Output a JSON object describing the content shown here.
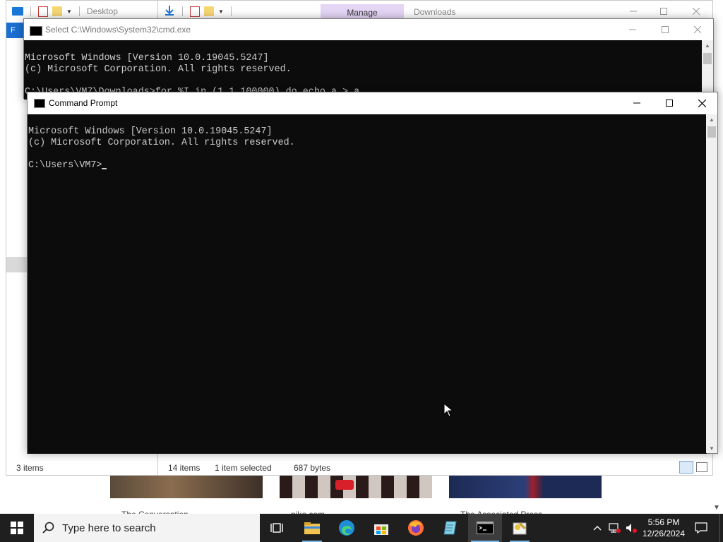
{
  "explorer_left": {
    "title": "Desktop",
    "ribbon_first_tab": "F",
    "status_items": "3 items"
  },
  "explorer_right": {
    "manage_tab": "Manage",
    "title": "Downloads",
    "status_items": "14 items",
    "status_selected": "1 item selected",
    "status_size": "687 bytes"
  },
  "cmd_back": {
    "title": "Select C:\\Windows\\System32\\cmd.exe",
    "lines": [
      "Microsoft Windows [Version 10.0.19045.5247]",
      "(c) Microsoft Corporation. All rights reserved.",
      "",
      "C:\\Users\\VM7\\Downloads>for %I in (1,1,100000) do echo a > a"
    ]
  },
  "cmd_front": {
    "title": "Command Prompt",
    "line1": "Microsoft Windows [Version 10.0.19045.5247]",
    "line2": "(c) Microsoft Corporation. All rights reserved.",
    "prompt": "C:\\Users\\VM7>"
  },
  "web_cards": [
    {
      "caption": "The Conversation"
    },
    {
      "caption": "nike.com"
    },
    {
      "caption": "The Associated Press"
    }
  ],
  "taskbar": {
    "search_placeholder": "Type here to search",
    "time": "5:56 PM",
    "date": "12/26/2024",
    "apps": [
      "task-view",
      "file-explorer",
      "edge",
      "store",
      "firefox",
      "notepad",
      "command-prompt",
      "paint"
    ],
    "accent_color": "#76b9ed"
  },
  "colors": {
    "console_bg": "#0c0c0c",
    "console_fg": "#cccccc",
    "manage_tab_bg": "#e6d6f6",
    "taskbar_bg": "#1f1f1f"
  }
}
